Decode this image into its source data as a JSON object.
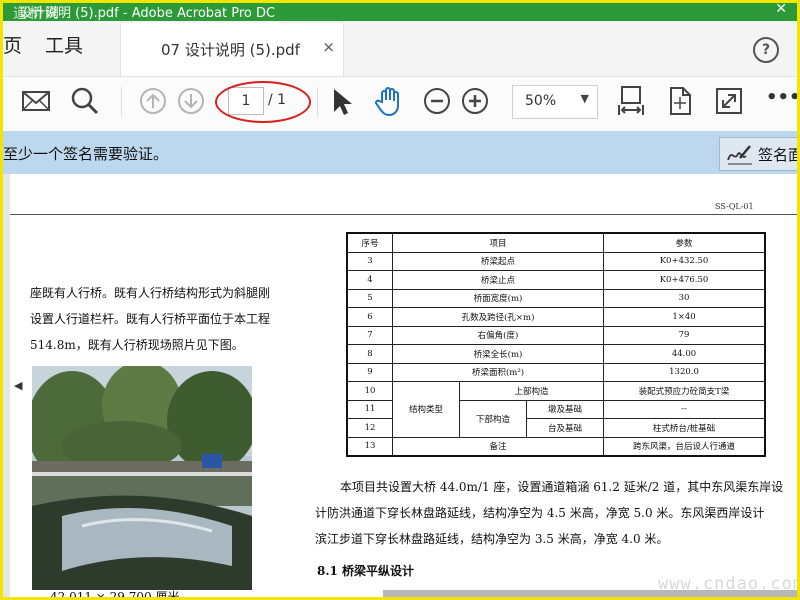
{
  "window": {
    "title": "设计说明 (5).pdf - Adobe Acrobat Pro DC",
    "watermark_top": "道桥网"
  },
  "tabs": {
    "home_partial": "页",
    "tools": "工具",
    "document_tab": "07 设计说明 (5).pdf",
    "close_glyph": "×",
    "help_glyph": "?"
  },
  "toolbar": {
    "page_current": "1",
    "page_total": "/ 1",
    "zoom": "50%",
    "more": "•••",
    "icons": [
      "mail-icon",
      "search-icon",
      "page-up-icon",
      "page-down-icon",
      "select-arrow-icon",
      "hand-icon",
      "zoom-out-icon",
      "zoom-in-icon",
      "fit-width-icon",
      "rotate-icon",
      "fullscreen-icon",
      "more-icon"
    ]
  },
  "notice": {
    "message": "至少一个签名需要验证。",
    "sign_button": "签名面"
  },
  "document": {
    "code": "SS-QL-01",
    "left_lines": [
      "座既有人行桥。既有人行桥结构形式为斜腿刚",
      "设置人行道栏杆。既有人行桥平面位于本工程",
      "514.8m，既有人行桥现场照片见下图。"
    ],
    "caption": "42.011 × 29.700 厘米",
    "table": {
      "headers": [
        "序号",
        "项目",
        "参数"
      ],
      "rows": [
        [
          "3",
          "桥梁起点",
          "K0+432.50"
        ],
        [
          "4",
          "桥梁止点",
          "K0+476.50"
        ],
        [
          "5",
          "桥面宽度(m)",
          "30"
        ],
        [
          "6",
          "孔数及跨径(孔×m)",
          "1×40"
        ],
        [
          "7",
          "右偏角(度)",
          "79"
        ],
        [
          "8",
          "桥梁全长(m)",
          "44.00"
        ],
        [
          "9",
          "桥梁面积(m²)",
          "1320.0"
        ]
      ],
      "struct_label": "结构类型",
      "row10": {
        "num": "10",
        "item": "上部构造",
        "value": "装配式预应力砼简支T梁"
      },
      "row11": {
        "num": "11",
        "sub": "下部构造",
        "item": "墩及基础",
        "value": "--"
      },
      "row12": {
        "num": "12",
        "item": "台及基础",
        "value": "柱式桥台/桩基础"
      },
      "row13": {
        "num": "13",
        "item": "备注",
        "value": "跨东风渠，台后设人行通道"
      }
    },
    "right_lines": [
      "本项目共设置大桥 44.0m/1 座，设置通道箱涵 61.2 延米/2 道，其中东风渠东岸设",
      "计防洪通道下穿长林盘路延线，结构净空为 4.5 米高，净宽 5.0 米。东风渠西岸设计",
      "滨江步道下穿长林盘路延线，结构净空为 3.5 米高，净宽 4.0 米。"
    ],
    "section_title": "8.1 桥梁平纵设计"
  },
  "watermark_bottom": "www.cndao.com",
  "colors": {
    "title_bar": "#2d9a3a",
    "notice_bar": "#bcd7ee",
    "highlight_ring": "#d81e1e",
    "border": "#f2e600"
  }
}
